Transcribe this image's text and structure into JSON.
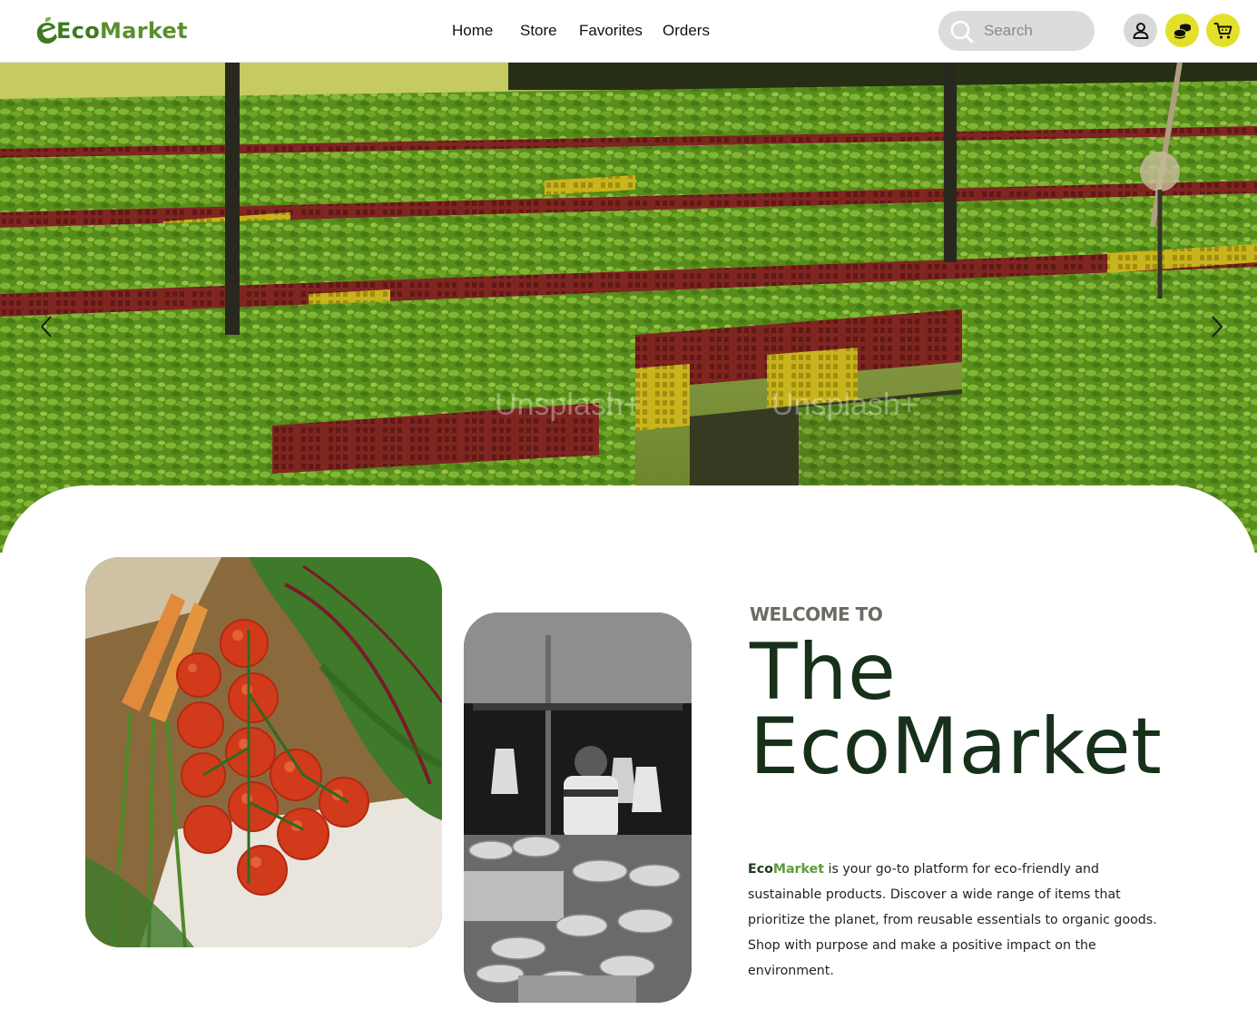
{
  "header": {
    "logo": {
      "text_a": "Eco",
      "text_b": "Market"
    },
    "nav": [
      {
        "label": "Home"
      },
      {
        "label": "Store"
      },
      {
        "label": "Favorites"
      },
      {
        "label": "Orders"
      }
    ],
    "search": {
      "placeholder": "Search"
    },
    "icons": {
      "user": "user-icon",
      "coins": "coins-icon",
      "cart": "cart-icon"
    },
    "colors": {
      "accent": "#e3e02a",
      "brand_green": "#3e7a1f"
    }
  },
  "hero": {
    "watermarks": [
      "Unsplash+",
      "Unsplash+"
    ]
  },
  "about": {
    "eyebrow": "WELCOME TO",
    "title_line1": "The",
    "title_line2": "EcoMarket",
    "brand_a": "Eco",
    "brand_b": "Market",
    "description": " is your go-to platform for eco-friendly and sustainable products. Discover a wide range of items that prioritize the planet, from reusable essentials to organic goods. Shop with purpose and make a positive impact on the environment."
  }
}
